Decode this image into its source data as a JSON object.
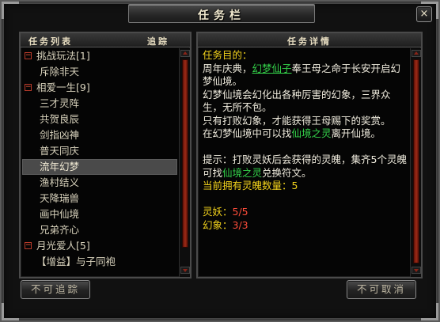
{
  "window": {
    "title": "任务栏",
    "close_label": "×"
  },
  "left_panel": {
    "title": "任务列表",
    "track_label": "追踪",
    "rows": [
      {
        "kind": "group",
        "toggle": "−",
        "label": "挑战玩法[1]"
      },
      {
        "kind": "item",
        "label": "斥除非天"
      },
      {
        "kind": "group",
        "toggle": "−",
        "label": "相爱一生[9]"
      },
      {
        "kind": "item",
        "label": "三才灵阵"
      },
      {
        "kind": "item",
        "label": "共贺良辰"
      },
      {
        "kind": "item",
        "label": "剑指凶神"
      },
      {
        "kind": "item",
        "label": "普天同庆"
      },
      {
        "kind": "item",
        "label": "流年幻梦",
        "selected": true
      },
      {
        "kind": "item",
        "label": "渔村结义"
      },
      {
        "kind": "item",
        "label": "天降瑞兽"
      },
      {
        "kind": "item",
        "label": "画中仙境"
      },
      {
        "kind": "item",
        "label": "兄弟齐心"
      },
      {
        "kind": "group",
        "toggle": "−",
        "label": "月光爱人[5]"
      },
      {
        "kind": "sub",
        "label": "【增益】与子同袍"
      }
    ]
  },
  "right_panel": {
    "title": "任务详情",
    "goal_label": "任务目的：",
    "line1_pre": "周年庆典，",
    "line1_link": "幻梦仙子",
    "line1_post": "奉王母之命于长安开启幻梦仙境。",
    "para2": "幻梦仙境会幻化出各种厉害的幻象，三界众生，无所不包。",
    "para3": "只有打败幻象，才能获得王母赐下的奖赏。",
    "para4_pre": "在幻梦仙境中可以找",
    "para4_link": "仙境之灵",
    "para4_post": "离开仙境。",
    "tip_pre": "提示：打败灵妖后会获得的灵魄，集齐5个灵魄可找",
    "tip_link": "仙境之灵",
    "tip_post": "兑换符文。",
    "count_label": "当前拥有灵魄数量：",
    "count_value": "5",
    "obj1_label": "灵妖：",
    "obj1_value": "5/5",
    "obj2_label": "幻象：",
    "obj2_value": "3/3"
  },
  "buttons": {
    "untrack": "不可追踪",
    "abandon": "不可取消"
  },
  "colors": {
    "heading": "#f2d21c",
    "link": "#34d24a",
    "progress": "#ff4d3a",
    "text": "#f0ecde"
  }
}
